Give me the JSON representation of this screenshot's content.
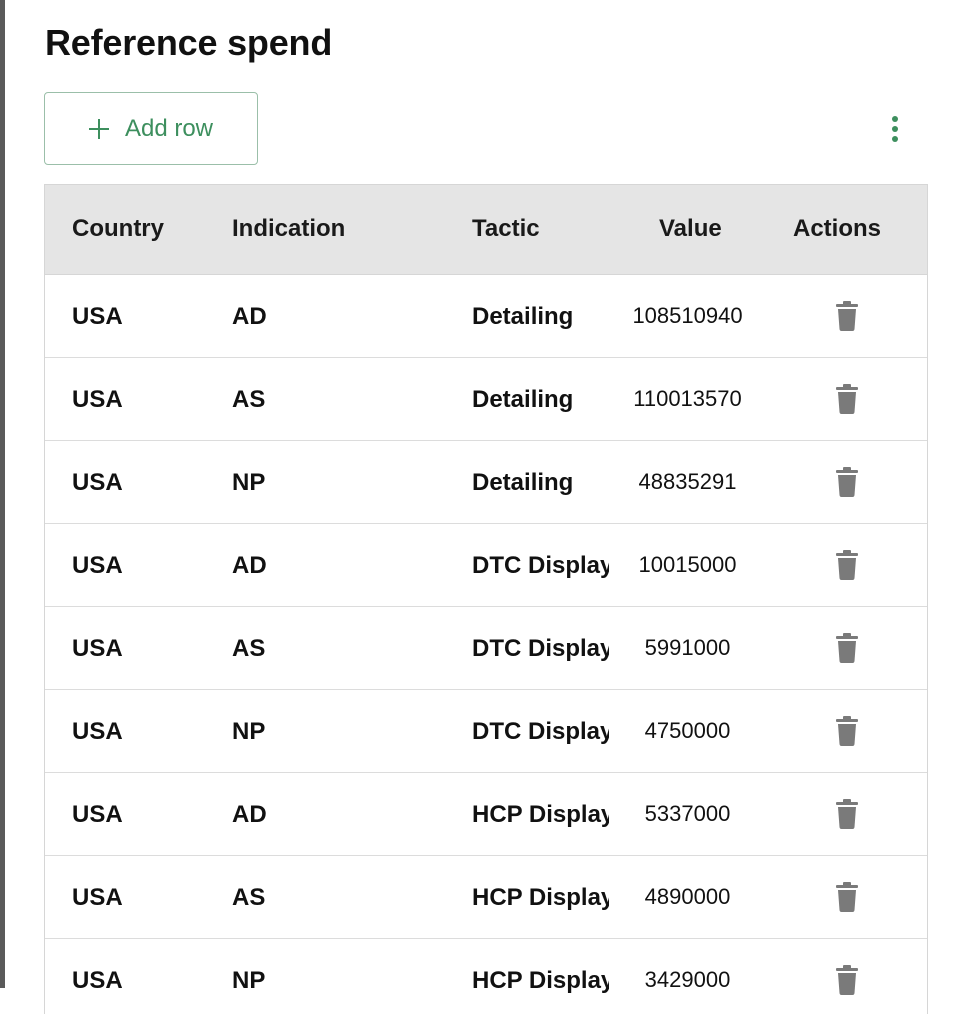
{
  "page": {
    "title": "Reference spend"
  },
  "toolbar": {
    "add_row_label": "Add row"
  },
  "table": {
    "headers": {
      "country": "Country",
      "indication": "Indication",
      "tactic": "Tactic",
      "value": "Value",
      "actions": "Actions"
    },
    "rows": [
      {
        "country": "USA",
        "indication": "AD",
        "tactic": "Detailing",
        "value": "108510940"
      },
      {
        "country": "USA",
        "indication": "AS",
        "tactic": "Detailing",
        "value": "110013570"
      },
      {
        "country": "USA",
        "indication": "NP",
        "tactic": "Detailing",
        "value": "48835291"
      },
      {
        "country": "USA",
        "indication": "AD",
        "tactic": "DTC Display",
        "value": "10015000"
      },
      {
        "country": "USA",
        "indication": "AS",
        "tactic": "DTC Display",
        "value": "5991000"
      },
      {
        "country": "USA",
        "indication": "NP",
        "tactic": "DTC Display",
        "value": "4750000"
      },
      {
        "country": "USA",
        "indication": "AD",
        "tactic": "HCP Display",
        "value": "5337000"
      },
      {
        "country": "USA",
        "indication": "AS",
        "tactic": "HCP Display",
        "value": "4890000"
      },
      {
        "country": "USA",
        "indication": "NP",
        "tactic": "HCP Display",
        "value": "3429000"
      }
    ]
  },
  "icons": {
    "add": "plus-icon",
    "more": "more-vertical-icon",
    "delete": "trash-icon"
  },
  "colors": {
    "accent": "#3d8f5e",
    "header_bg": "#e5e5e5",
    "icon_gray": "#7a7a7a"
  }
}
